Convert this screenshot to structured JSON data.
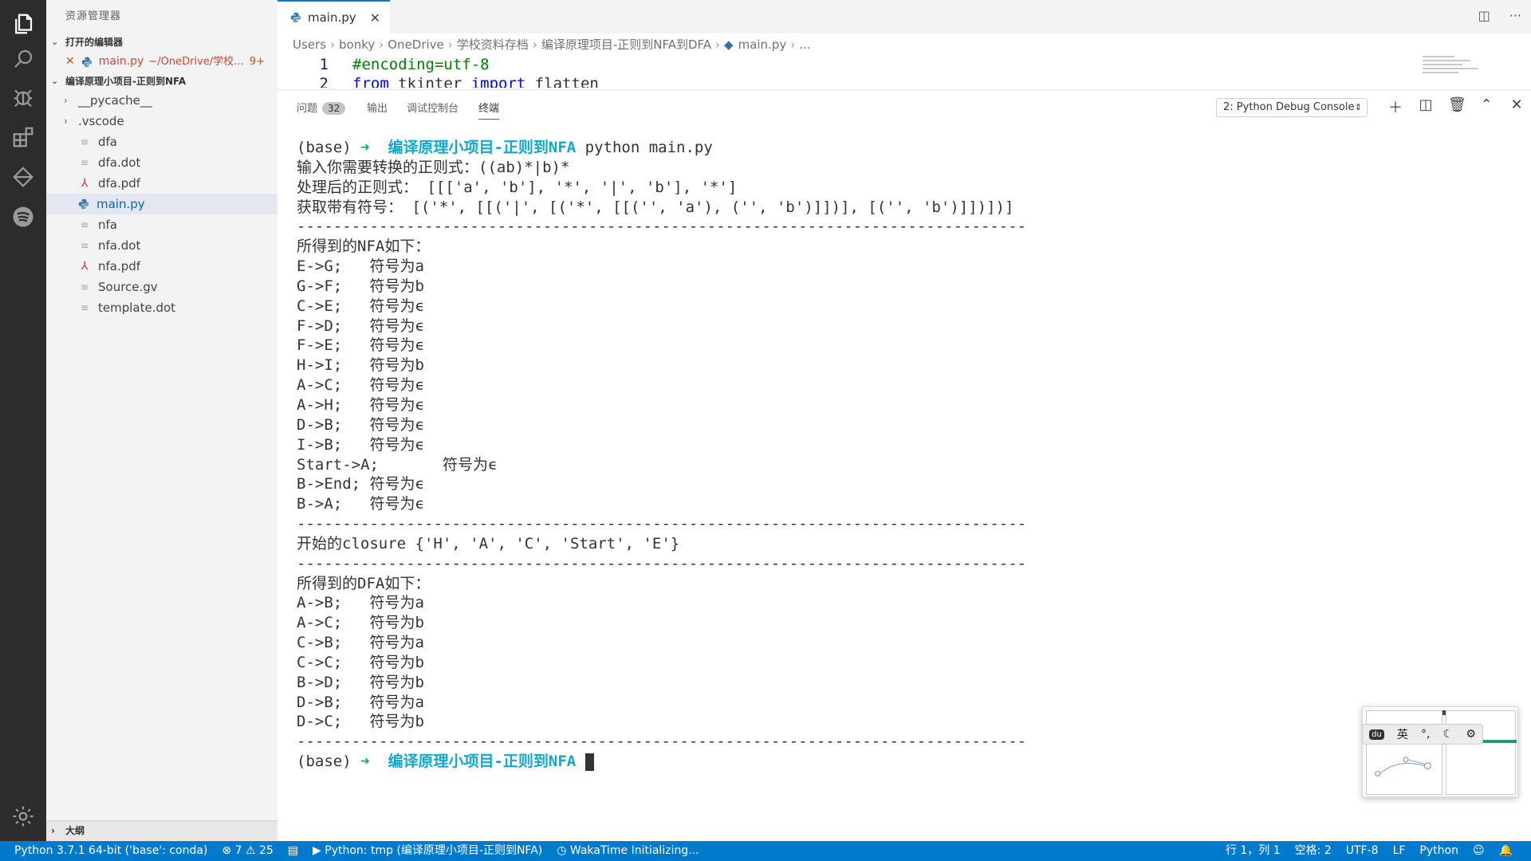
{
  "sidebar": {
    "title": "资源管理器",
    "open_editors_label": "打开的编辑器",
    "open_file": {
      "name": "main.py",
      "path": "~/OneDrive/学校...",
      "badge": "9+"
    },
    "project_label": "编译原理小项目-正则到NFA",
    "tree": [
      {
        "name": "__pycache__",
        "type": "folder"
      },
      {
        "name": ".vscode",
        "type": "folder"
      },
      {
        "name": "dfa",
        "type": "file"
      },
      {
        "name": "dfa.dot",
        "type": "file"
      },
      {
        "name": "dfa.pdf",
        "type": "pdf"
      },
      {
        "name": "main.py",
        "type": "python"
      },
      {
        "name": "nfa",
        "type": "file"
      },
      {
        "name": "nfa.dot",
        "type": "file"
      },
      {
        "name": "nfa.pdf",
        "type": "pdf"
      },
      {
        "name": "Source.gv",
        "type": "file"
      },
      {
        "name": "template.dot",
        "type": "file"
      }
    ],
    "outline_label": "大纲"
  },
  "editor": {
    "tab_label": "main.py",
    "breadcrumb": [
      "Users",
      "bonky",
      "OneDrive",
      "学校资料存档",
      "编译原理项目-正则到NFA到DFA",
      "main.py",
      "..."
    ],
    "lines": [
      {
        "num": "1",
        "text": "#encoding=utf-8"
      },
      {
        "num": "2",
        "kw1": "from",
        "mid": " tkinter ",
        "kw2": "import",
        "rest": " flatten"
      }
    ]
  },
  "panel": {
    "tabs": {
      "problems": "问题",
      "problems_count": "32",
      "output": "输出",
      "debug_console": "调试控制台",
      "terminal": "终端"
    },
    "console_select": "2: Python Debug Console"
  },
  "terminal": {
    "prompt_env": "(base)",
    "prompt_arrow": "➜",
    "prompt_dir": "编译原理小项目-正则到NFA",
    "command": "python main.py",
    "input_line": "输入你需要转换的正则式：((ab)*|b)*",
    "processed_line": "处理后的正则式： [[['a', 'b'], '*', '|', 'b'], '*']",
    "symbols_line": "获取带有符号： [('*', [[('|', [('*', [[('', 'a'), ('', 'b')]])], [('', 'b')]])])]",
    "divider": "--------------------------------------------------------------------------------",
    "nfa_title": "所得到的NFA如下：",
    "nfa_edges": [
      "E->G;   符号为a",
      "G->F;   符号为b",
      "C->E;   符号为ϵ",
      "F->D;   符号为ϵ",
      "F->E;   符号为ϵ",
      "H->I;   符号为b",
      "A->C;   符号为ϵ",
      "A->H;   符号为ϵ",
      "D->B;   符号为ϵ",
      "I->B;   符号为ϵ",
      "Start->A;       符号为ϵ",
      "B->End; 符号为ϵ",
      "B->A;   符号为ϵ"
    ],
    "closure_line": "开始的closure {'H', 'A', 'C', 'Start', 'E'}",
    "dfa_title": "所得到的DFA如下：",
    "dfa_edges": [
      "A->B;   符号为a",
      "A->C;   符号为b",
      "C->B;   符号为a",
      "C->C;   符号为b",
      "B->D;   符号为b",
      "D->B;   符号为a",
      "D->C;   符号为b"
    ]
  },
  "ime": {
    "lang": "英",
    "punct": "°,"
  },
  "statusbar": {
    "interpreter": "Python 3.7.1 64-bit ('base': conda)",
    "errors": "7",
    "warnings": "25",
    "run_target": "Python: tmp (编译原理小项目-正则到NFA)",
    "wakatime": "WakaTime Initializing...",
    "position": "行 1，列 1",
    "spaces": "空格: 2",
    "encoding": "UTF-8",
    "eol": "LF",
    "language": "Python"
  },
  "colors": {
    "accent": "#007acc",
    "error": "#c74a31",
    "prompt_dir": "#11a8cd",
    "prompt_arrow": "#16a085"
  }
}
